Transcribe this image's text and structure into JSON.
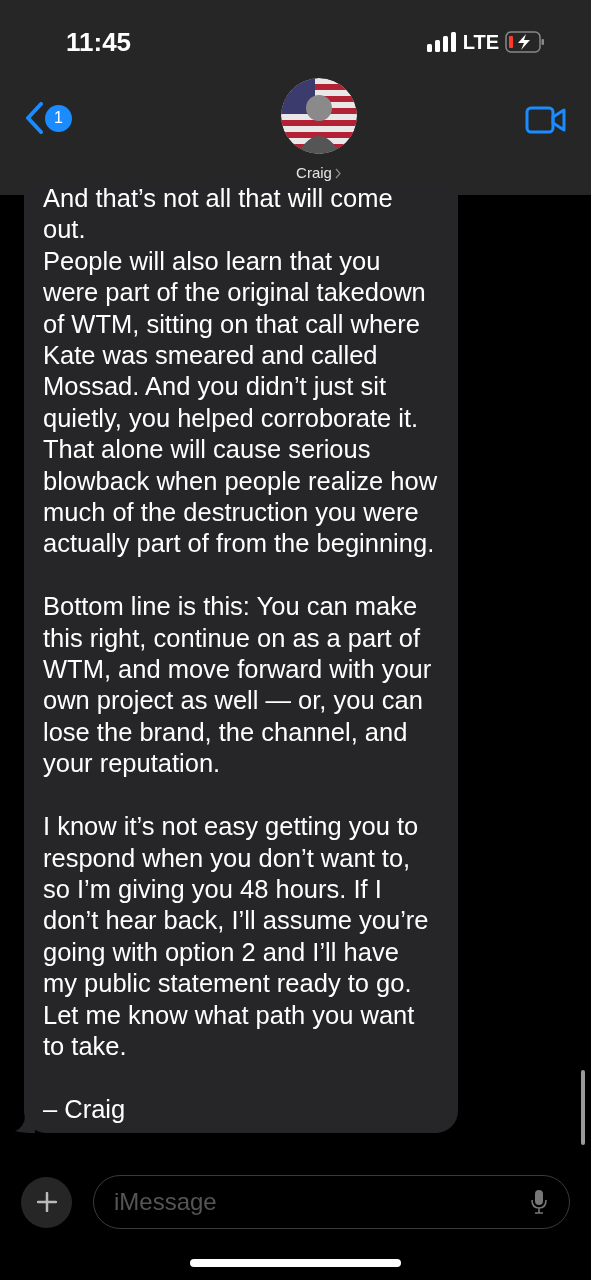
{
  "status_bar": {
    "time": "11:45",
    "network": "LTE"
  },
  "header": {
    "back_badge": "1",
    "contact_name": "Craig"
  },
  "message": {
    "paragraphs": [
      {
        "text": "And that’s not all that will come out.",
        "gap_before": false
      },
      {
        "text": "People will also learn that you were part of the original takedown of WTM, sitting on that call where Kate was smeared and called Mossad. And you didn’t just sit quietly, you helped corroborate it. That alone will cause serious blowback when people realize how much of the destruction you were actually part of from the beginning.",
        "gap_before": false
      },
      {
        "text": "Bottom line is this: You can make this right, continue on as a part of WTM, and move forward with your own project as well — or, you can lose the brand, the channel, and your reputation.",
        "gap_before": true
      },
      {
        "text": "I know it’s not easy getting you to respond when you don’t want to, so I’m giving you 48 hours. If I don’t hear back, I’ll assume you’re going with option 2 and I’ll have my public statement ready to go. Let me know what path you want to take.",
        "gap_before": true
      },
      {
        "text": "– Craig",
        "gap_before": true
      }
    ]
  },
  "composer": {
    "placeholder": "iMessage"
  }
}
